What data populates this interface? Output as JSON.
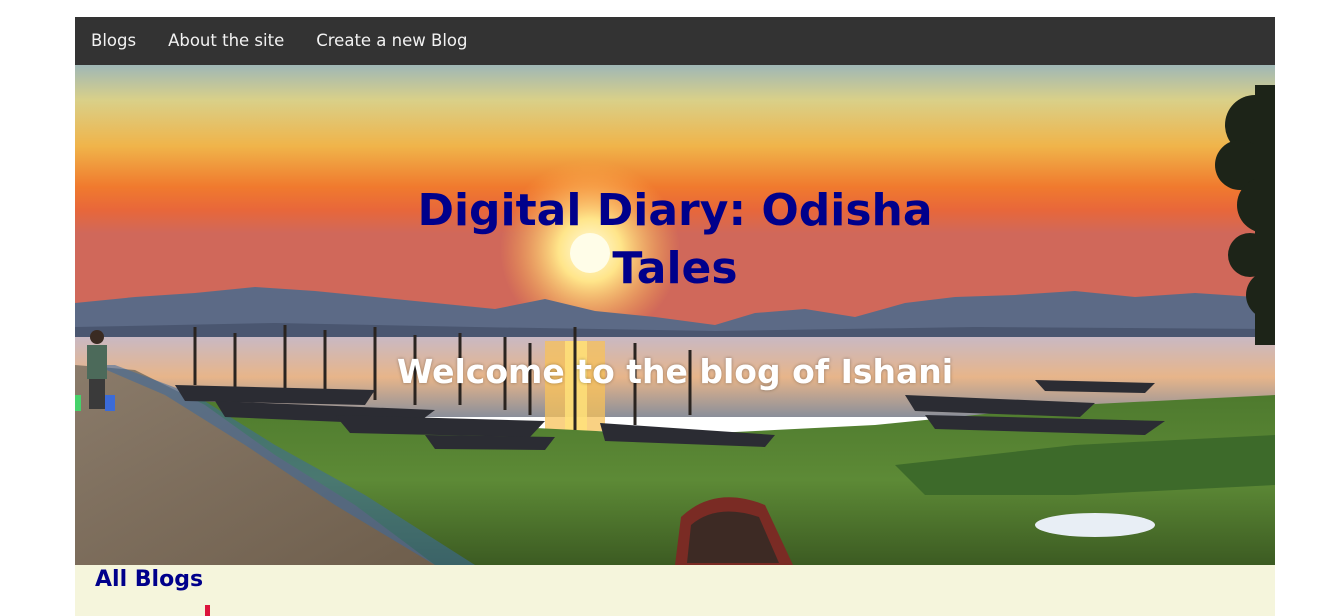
{
  "nav": {
    "items": [
      {
        "label": "Blogs"
      },
      {
        "label": "About the site"
      },
      {
        "label": "Create a new Blog"
      }
    ]
  },
  "hero": {
    "title_line1": "Digital Diary: Odisha",
    "title_line2": "Tales",
    "subtitle": "Welcome to the blog of Ishani",
    "image": "sunset-lake-boats-photo"
  },
  "content": {
    "heading": "All Blogs"
  },
  "colors": {
    "nav_bg": "#333333",
    "nav_text": "#f2f2f2",
    "title": "#00008b",
    "subtitle": "#ffffff",
    "content_bg": "#f5f5dc",
    "accent": "#dc143c"
  }
}
